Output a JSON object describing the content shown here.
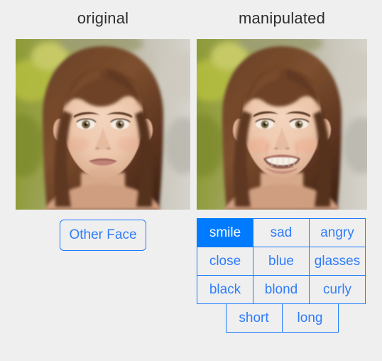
{
  "colors": {
    "background": "#efefef",
    "accent_blue": "#007bff",
    "button_text_blue": "#2f7dfb",
    "title_text": "#2d2d2d",
    "active_text": "#ffffff"
  },
  "columns": {
    "original_label": "original",
    "manipulated_label": "manipulated"
  },
  "images": {
    "original": {
      "alt": "original-face-photo",
      "description": "portrait of a woman with brown hair and bangs, neutral closed-mouth expression, blurred green foliage background"
    },
    "manipulated": {
      "alt": "manipulated-face-photo",
      "description": "same portrait of the woman, edited to show a wide open-mouth smile with visible teeth, blurred green foliage background"
    }
  },
  "controls": {
    "other_face_label": "Other Face"
  },
  "attribute_grid": {
    "rows": [
      [
        {
          "label": "smile",
          "active": true
        },
        {
          "label": "sad",
          "active": false
        },
        {
          "label": "angry",
          "active": false
        }
      ],
      [
        {
          "label": "close",
          "active": false
        },
        {
          "label": "blue",
          "active": false
        },
        {
          "label": "glasses",
          "active": false
        }
      ],
      [
        {
          "label": "black",
          "active": false
        },
        {
          "label": "blond",
          "active": false
        },
        {
          "label": "curly",
          "active": false
        }
      ],
      [
        {
          "label": "short",
          "active": false
        },
        {
          "label": "long",
          "active": false
        }
      ]
    ]
  }
}
